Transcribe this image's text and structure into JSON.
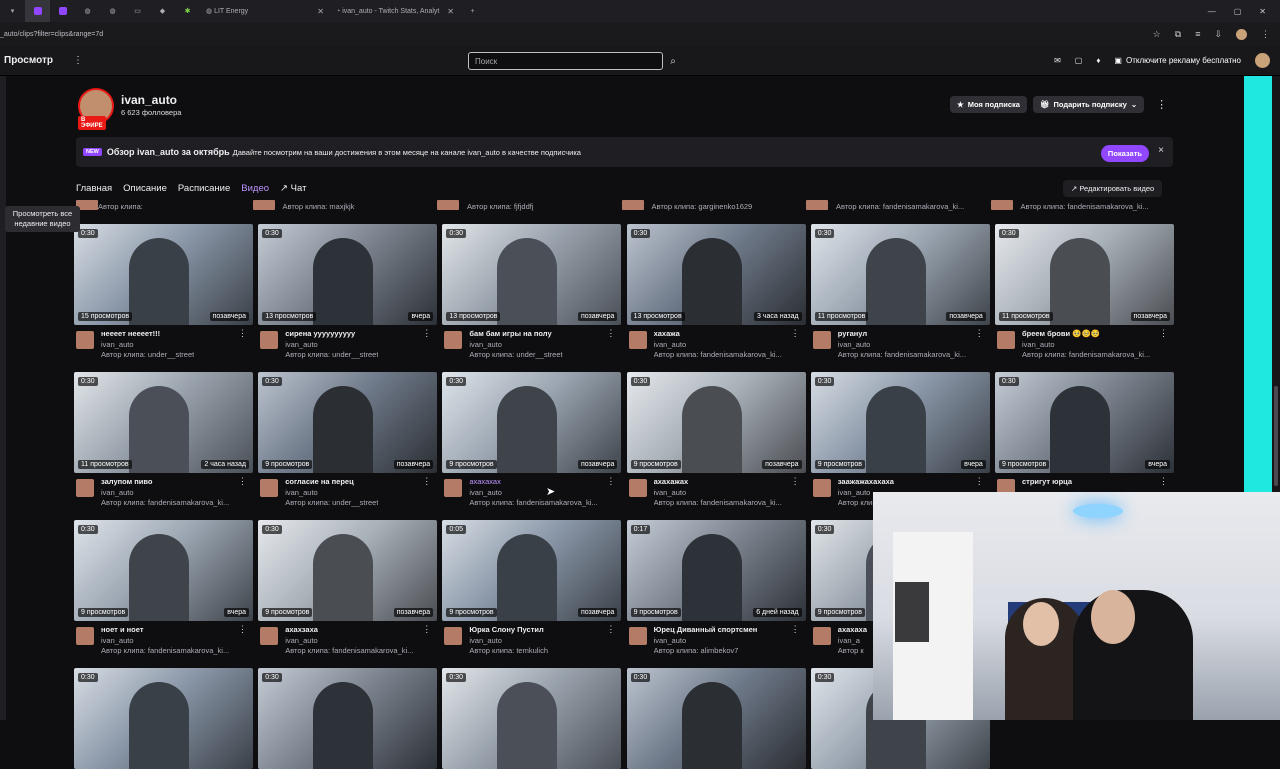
{
  "browser": {
    "tabs": [
      {
        "label": "",
        "active": false
      },
      {
        "label": "",
        "active": true
      },
      {
        "label": "",
        "active": false
      },
      {
        "label": "",
        "active": false
      },
      {
        "label": "",
        "active": false
      },
      {
        "label": "",
        "active": false
      },
      {
        "label": "",
        "active": false
      },
      {
        "label": "",
        "active": false
      },
      {
        "label": "LIT Energy",
        "active": false
      },
      {
        "label": "ivan_auto - Twitch Stats, Analyt",
        "active": false
      }
    ],
    "new_tab": "+",
    "url": "_auto/clips?filter=clips&range=7d"
  },
  "topnav": {
    "brand": "Просмотр",
    "search_placeholder": "Поиск",
    "ad_label": "Отключите рекламу бесплатно"
  },
  "tooltip": "Просмотреть все недавние видео",
  "channel": {
    "name": "ivan_auto",
    "followers": "6 623 фолловера",
    "live_label": "В ЭФИРЕ",
    "subscribe_label": "Моя подписка",
    "gift_label": "Подарить подписку"
  },
  "banner": {
    "badge": "NEW",
    "title": "Обзор ivan_auto за октябрь",
    "desc": "Давайте посмотрим на ваши достижения в этом месяце на канале ivan_auto в качестве подписчика",
    "button": "Показать",
    "close": "×"
  },
  "tabs": [
    "Главная",
    "Описание",
    "Расписание",
    "Видео",
    "Чат"
  ],
  "edit_videos": "Редактировать видео",
  "partial_row": [
    "Автор клипа:",
    "Автор клипа: maxjkjk",
    "Автор клипа: fjfjddfj",
    "Автор клипа: garginenko1629",
    "Автор клипа: fandenisamakarova_ki...",
    "Автор клипа: fandenisamakarova_ki..."
  ],
  "clips": [
    [
      {
        "dur": "0:30",
        "views": "15 просмотров",
        "when": "позавчера",
        "title": "нееeет нееeет!!!",
        "author": "ivan_auto",
        "clip": "Автор клипа: under__street"
      },
      {
        "dur": "0:30",
        "views": "13 просмотров",
        "when": "вчера",
        "title": "сирена уууууууууу",
        "author": "ivan_auto",
        "clip": "Автор клипа: under__street"
      },
      {
        "dur": "0:30",
        "views": "13 просмотров",
        "when": "позавчера",
        "title": "бам бам игры на полу",
        "author": "ivan_auto",
        "clip": "Автор клипа: under__street"
      },
      {
        "dur": "0:30",
        "views": "13 просмотров",
        "when": "3 часа назад",
        "title": "хахажа",
        "author": "ivan_auto",
        "clip": "Автор клипа: fandenisamakarova_ki..."
      },
      {
        "dur": "0:30",
        "views": "11 просмотров",
        "when": "позавчера",
        "title": "руганул",
        "author": "ivan_auto",
        "clip": "Автор клипа: fandenisamakarova_ki..."
      },
      {
        "dur": "0:30",
        "views": "11 просмотров",
        "when": "позавчера",
        "title": "бреем брови 🥺🥺🥺",
        "author": "ivan_auto",
        "clip": "Автор клипа: fandenisamakarova_ki..."
      }
    ],
    [
      {
        "dur": "0:30",
        "views": "11 просмотров",
        "when": "2 часа назад",
        "title": "залупом пиво",
        "author": "ivan_auto",
        "clip": "Автор клипа: fandenisamakarova_ki..."
      },
      {
        "dur": "0:30",
        "views": "9 просмотров",
        "when": "позавчера",
        "title": "согласие на перец",
        "author": "ivan_auto",
        "clip": "Автор клипа: under__street"
      },
      {
        "dur": "0:30",
        "views": "9 просмотров",
        "when": "позавчера",
        "title": "ахахахах",
        "author": "ivan_auto",
        "clip": "Автор клипа: fandenisamakarova_ki..."
      },
      {
        "dur": "0:30",
        "views": "9 просмотров",
        "when": "позавчера",
        "title": "ахахажах",
        "author": "ivan_auto",
        "clip": "Автор клипа: fandenisamakarova_ki..."
      },
      {
        "dur": "0:30",
        "views": "9 просмотров",
        "when": "вчера",
        "title": "заажажахахаха",
        "author": "ivan_auto",
        "clip": "Автор клипа"
      },
      {
        "dur": "0:30",
        "views": "9 просмотров",
        "when": "вчера",
        "title": "стригут юрца",
        "author": "",
        "clip": ""
      }
    ],
    [
      {
        "dur": "0:30",
        "views": "9 просмотров",
        "when": "вчера",
        "title": "ноет и ноет",
        "author": "ivan_auto",
        "clip": "Автор клипа: fandenisamakarova_ki..."
      },
      {
        "dur": "0:30",
        "views": "9 просмотров",
        "when": "позавчера",
        "title": "ахахзаха",
        "author": "ivan_auto",
        "clip": "Автор клипа: fandenisamakarova_ki..."
      },
      {
        "dur": "0:05",
        "views": "9 просмотров",
        "when": "позавчера",
        "title": "Юрка Слону Пустил",
        "author": "ivan_auto",
        "clip": "Автор клипа: temkulich"
      },
      {
        "dur": "0:17",
        "views": "9 просмотров",
        "when": "6 дней назад",
        "title": "Юрец Диванный спортсмен",
        "author": "ivan_auto",
        "clip": "Автор клипа: alimbekov7"
      },
      {
        "dur": "0:30",
        "views": "9 просмотров",
        "when": "",
        "title": "ахахаха",
        "author": "ivan_a",
        "clip": "Автор к"
      }
    ],
    [
      {
        "dur": "0:30"
      },
      {
        "dur": "0:30"
      },
      {
        "dur": "0:30"
      },
      {
        "dur": "0:30"
      },
      {
        "dur": "0:30"
      }
    ]
  ]
}
